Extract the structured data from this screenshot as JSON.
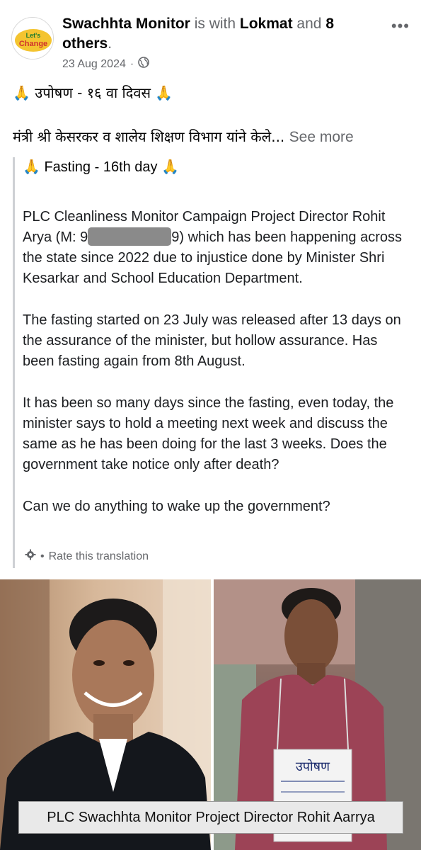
{
  "post": {
    "author": "Swachhta Monitor",
    "with_text": "is with",
    "tagged": "Lokmat",
    "and_text": "and",
    "others": "8 others",
    "date": "23 Aug 2024",
    "separator": "·",
    "more_icon": "more-options-icon",
    "logo_text": "Let's Change"
  },
  "content": {
    "title": "🙏 उपोषण - १६ वा दिवस 🙏",
    "preview": "मंत्री श्री केसरकर व शालेय शिक्षण विभाग यांने केले...",
    "see_more": "See more"
  },
  "translation": {
    "heading": "🙏 Fasting - 16th day 🙏",
    "p1_a": "PLC Cleanliness Monitor Campaign Project Director Rohit Arya (M: 9",
    "p1_b": "9) which has been happening across the state since 2022 due to injustice done by Minister Shri Kesarkar and School Education Department.",
    "p2": "The fasting started on 23 July was released after 13 days on the assurance of the minister, but hollow assurance. Has been fasting again from 8th August.",
    "p3": "It has been so many days since the fasting, even today, the minister says to hold a meeting next week and discuss the same as he has been doing for the last 3 weeks. Does the government take notice only after death?",
    "p4": "Can we do anything to wake up the government?",
    "rate_label": "Rate this translation",
    "rate_separator": "•"
  },
  "photo": {
    "sign_text": "उपोषण",
    "caption": "PLC Swachhta Monitor Project Director Rohit Aarrya"
  }
}
